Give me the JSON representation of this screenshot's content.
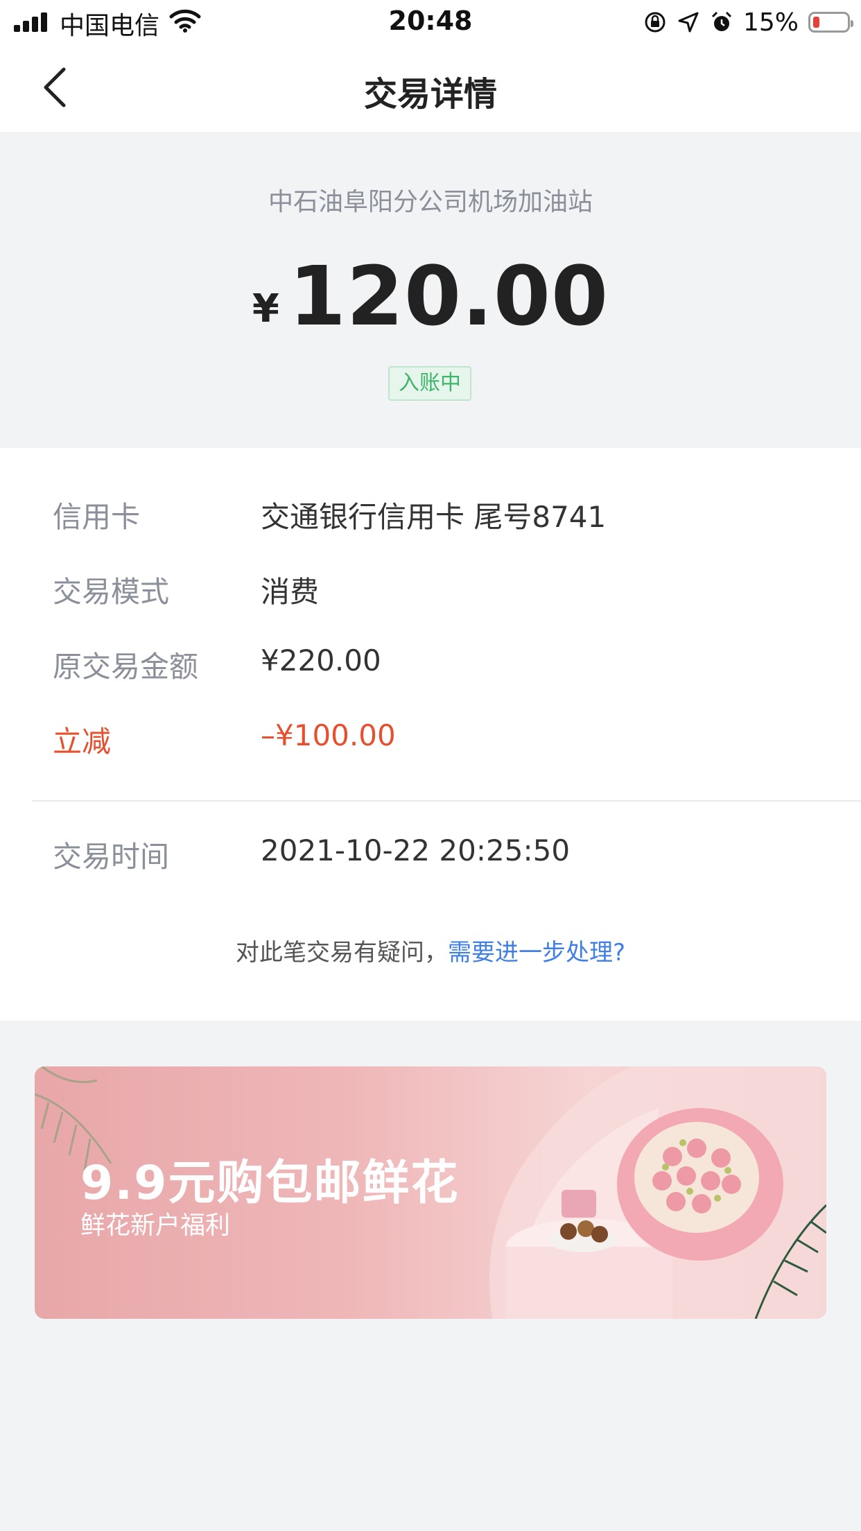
{
  "status_bar": {
    "carrier": "中国电信",
    "time": "20:48",
    "battery_percent": "15%",
    "battery_level": 0.15,
    "icons": [
      "signal-icon",
      "wifi-icon",
      "orientation-lock-icon",
      "location-icon",
      "alarm-icon",
      "battery-icon"
    ]
  },
  "nav": {
    "title": "交易详情",
    "back_icon": "chevron-left-icon"
  },
  "summary": {
    "merchant": "中石油阜阳分公司机场加油站",
    "currency_symbol": "¥",
    "amount": "120.00",
    "status": "入账中"
  },
  "details": {
    "rows": [
      {
        "label": "信用卡",
        "value": "交通银行信用卡 尾号8741"
      },
      {
        "label": "交易模式",
        "value": "消费"
      },
      {
        "label": "原交易金额",
        "value": "¥220.00"
      },
      {
        "label": "立减",
        "value": "–¥100.00"
      }
    ],
    "time_row": {
      "label": "交易时间",
      "value": "2021-10-22 20:25:50"
    },
    "question_text": "对此笔交易有疑问，",
    "question_link": "需要进一步处理?"
  },
  "banner": {
    "title": "9.9元购包邮鲜花",
    "subtitle": "鲜花新户福利"
  },
  "colors": {
    "accent_link": "#3f7fe6",
    "discount_red": "#e6502f",
    "status_green": "#3fb46a",
    "page_bg": "#f2f3f5"
  }
}
